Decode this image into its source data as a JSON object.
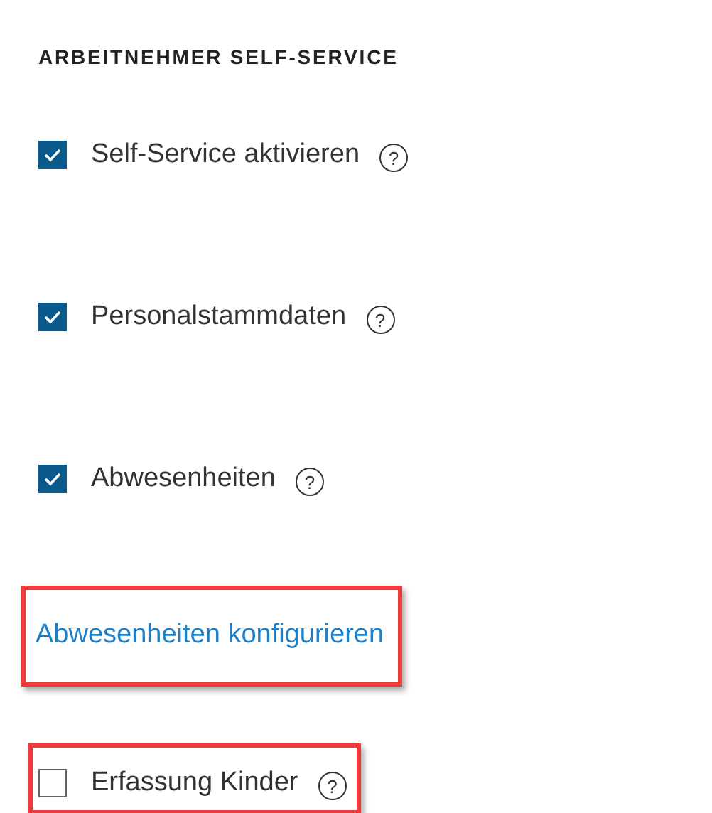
{
  "section_title": "ARBEITNEHMER SELF-SERVICE",
  "items": [
    {
      "kind": "checkbox",
      "label": "Self-Service aktivieren",
      "checked": true,
      "help": "?",
      "highlighted": false
    },
    {
      "kind": "checkbox",
      "label": "Personalstammdaten",
      "checked": true,
      "help": "?",
      "highlighted": false
    },
    {
      "kind": "checkbox",
      "label": "Abwesenheiten",
      "checked": true,
      "help": "?",
      "highlighted": false
    },
    {
      "kind": "link",
      "label": "Abwesenheiten konfigurieren",
      "highlighted": true
    },
    {
      "kind": "checkbox",
      "label": "Erfassung Kinder",
      "checked": false,
      "help": "?",
      "highlighted": true
    }
  ]
}
